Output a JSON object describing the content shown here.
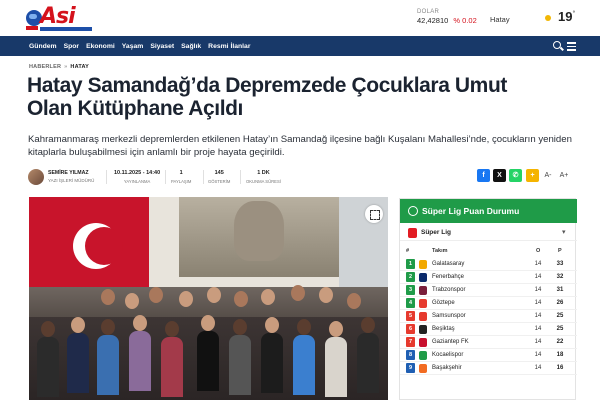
{
  "header": {
    "logo_text": "Asi",
    "fx_label": "DOLAR",
    "fx_value": "42,42810",
    "fx_change": "% 0.02",
    "city": "Hatay",
    "temperature": "19",
    "temperature_unit": "°",
    "weather_icon": "sun-icon"
  },
  "nav": {
    "items": [
      "Gündem",
      "Spor",
      "Ekonomi",
      "Yaşam",
      "Siyaset",
      "Sağlık",
      "Resmi İlanlar"
    ]
  },
  "breadcrumb": {
    "parent": "HABERLER",
    "separator": "»",
    "current": "HATAY"
  },
  "article": {
    "title": "Hatay Samandağ’da Depremzede Çocuklara Umut Olan Kütüphane Açıldı",
    "lead": "Kahramanmaraş merkezli depremlerden etkilenen Hatay’ın Samandağ ilçesine bağlı Kuşalanı Mahallesi’nde, çocukların yeniden kitaplarla buluşabilmesi için anlamlı bir proje hayata geçirildi."
  },
  "meta": {
    "author_name": "SEMİRE YILMAZ",
    "author_role": "YAZI İŞLERİ MÜDÜRÜ",
    "published_value": "10.11.2025 - 14:40",
    "published_label": "YAYINLANMA",
    "shares_value": "1",
    "shares_label": "PAYLAŞIM",
    "views_value": "145",
    "views_label": "GÖSTERİM",
    "reading_value": "1 DK",
    "reading_label": "OKUNMA SÜRESİ",
    "share_buttons": [
      {
        "icon": "facebook-icon",
        "glyph": "f",
        "color": "#1877f2"
      },
      {
        "icon": "x-icon",
        "glyph": "X",
        "color": "#111111"
      },
      {
        "icon": "whatsapp-icon",
        "glyph": "✆",
        "color": "#25d366"
      },
      {
        "icon": "plus-icon",
        "glyph": "+",
        "color": "#f5b400"
      }
    ],
    "font_decrease": "A-",
    "font_increase": "A+"
  },
  "standings": {
    "title": "Süper Lig Puan Durumu",
    "league": "Süper Lig",
    "columns": {
      "team": "Takım",
      "played": "O",
      "points": "P"
    },
    "rows": [
      {
        "pos": "1",
        "team": "Galatasaray",
        "played": "14",
        "points": "33",
        "pos_color": "#1f9b48",
        "crest_color": "#f2a900"
      },
      {
        "pos": "2",
        "team": "Fenerbahçe",
        "played": "14",
        "points": "32",
        "pos_color": "#1f9b48",
        "crest_color": "#0b2a6b"
      },
      {
        "pos": "3",
        "team": "Trabzonspor",
        "played": "14",
        "points": "31",
        "pos_color": "#1f9b48",
        "crest_color": "#7a1e3a"
      },
      {
        "pos": "4",
        "team": "Göztepe",
        "played": "14",
        "points": "26",
        "pos_color": "#1f9b48",
        "crest_color": "#e63a2e"
      },
      {
        "pos": "5",
        "team": "Samsunspor",
        "played": "14",
        "points": "25",
        "pos_color": "#e63a2e",
        "crest_color": "#e63a2e"
      },
      {
        "pos": "6",
        "team": "Beşiktaş",
        "played": "14",
        "points": "25",
        "pos_color": "#e63a2e",
        "crest_color": "#222222"
      },
      {
        "pos": "7",
        "team": "Gaziantep FK",
        "played": "14",
        "points": "22",
        "pos_color": "#e63a2e",
        "crest_color": "#c8102e"
      },
      {
        "pos": "8",
        "team": "Kocaelispor",
        "played": "14",
        "points": "18",
        "pos_color": "#1f5fb3",
        "crest_color": "#1f9b48"
      },
      {
        "pos": "9",
        "team": "Başakşehir",
        "played": "14",
        "points": "16",
        "pos_color": "#1f5fb3",
        "crest_color": "#f26b21"
      }
    ]
  },
  "colors": {
    "nav_bg": "#183969",
    "brand_red": "#d4121c",
    "widget_green": "#1f9b48"
  }
}
